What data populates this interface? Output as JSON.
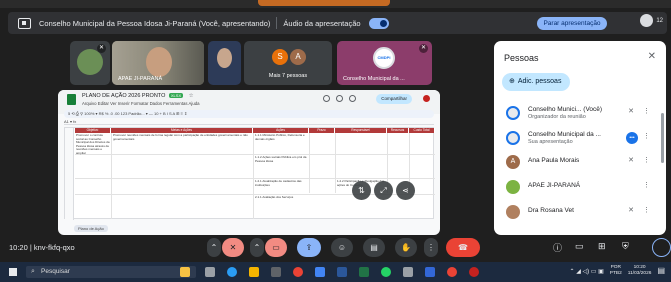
{
  "presenting_bar": {
    "text": "Conselho Municipal da Pessoa Idosa Ji-Paraná (Você, apresentando)",
    "audio_label": "Áudio da apresentação",
    "stop_label": "Parar apresentação",
    "people_count": "12"
  },
  "tiles": [
    {
      "name": ""
    },
    {
      "name": "APAE JI-PARANÁ"
    },
    {
      "name": ""
    },
    {
      "initials": [
        "S",
        "A"
      ],
      "name": "Mais 7 pessoas"
    },
    {
      "name": "Conselho Municipal da ...",
      "logo_text": "CMDPI"
    }
  ],
  "sheet": {
    "title": "PLANO DE AÇÃO 2026 PRONTO",
    "title_badge": "XLSX",
    "menu": "Arquivo  Editar  Ver  Inserir  Formatar  Dados  Ferramentas  Ajuda",
    "share_label": "Compartilhar",
    "toolbar": "5  ⟲  ⎙  ⚲  100%  ▾  R$  %  .0  .00  123  Padrão...  ▾  —  10  +  B  I  S  A  ⊞  ≡  ⇕",
    "formula": "A1   ▾   fx",
    "headers": [
      "Objetivo",
      "Metas e Ações",
      "Ações",
      "Prazo",
      "Responsável",
      "Recursos",
      "Custo Total"
    ],
    "cells": [
      "Promover o controle social ao Conselho Municipal dos Direitos da Pessoa Idosa através de reuniões mensais e ampliar",
      "Promover reuniões mensais de forma regular com a participação de entidades governamentais e não governamentais",
      "1.1.1 Ministério Público, Defensoria e demais órgãos",
      "1.1.2 Ações sociais Pública em prol da Pessoa Idosa",
      "1.2.1 Atualização de cadastros das instituições",
      "1.2.2 Participação e divulgação das ações do Conselho",
      "2.1.1 Avaliação dos Serviços"
    ],
    "sheet_tab": "Plano de Ação"
  },
  "panel": {
    "title": "Pessoas",
    "add_label": "Adic. pessoas",
    "people": [
      {
        "name": "Conselho Munici... (Você)",
        "sub": "Organizador da reunião",
        "initial": ""
      },
      {
        "name": "Conselho Municipal da ...",
        "sub": "Sua apresentação",
        "initial": ""
      },
      {
        "name": "Ana Paula Morais",
        "sub": "",
        "initial": "A"
      },
      {
        "name": "APAE JI-PARANÁ",
        "sub": "",
        "initial": ""
      },
      {
        "name": "Dra Rosana Vet",
        "sub": "",
        "initial": ""
      }
    ]
  },
  "call": {
    "time_code": "10:20  |  knv-fkfq-qxo"
  },
  "taskbar": {
    "search_placeholder": "Pesquisar",
    "lang": "POR",
    "layout": "PTB2",
    "time": "10:20",
    "date": "11/03/2026"
  },
  "colors": {
    "accent": "#8ab4f8",
    "end_call": "#ea4335",
    "sheet_header": "#b23a3a",
    "panel_bg": "#ffffff"
  }
}
